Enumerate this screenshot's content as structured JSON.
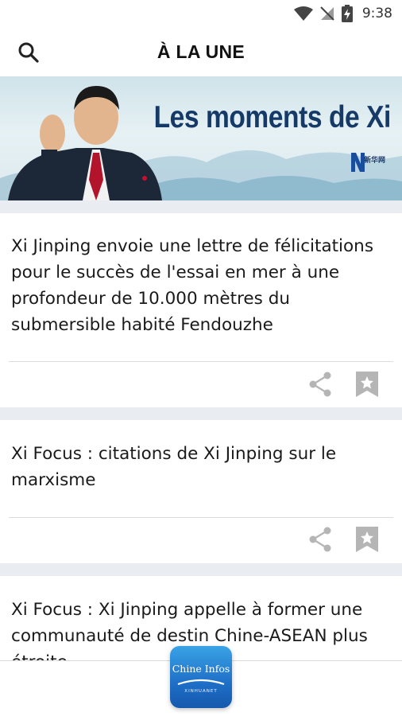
{
  "status_bar": {
    "time": "9:38"
  },
  "header": {
    "title": "À LA UNE"
  },
  "banner": {
    "title": "Les moments de Xi",
    "logo_text": "新华网"
  },
  "articles": [
    {
      "title": "Xi Jinping envoie une lettre de félicitations pour le succès de l'essai en mer à une profondeur de 10.000 mètres du submersible habité Fendouzhe"
    },
    {
      "title": "Xi Focus : citations de Xi Jinping sur le marxisme"
    },
    {
      "title": "Xi Focus : Xi Jinping appelle à former une communauté de destin Chine-ASEAN plus étroite"
    }
  ],
  "app_badge": {
    "name": "Chine Infos",
    "subtitle": "XINHUANET"
  },
  "colors": {
    "accent": "#163a67",
    "separator": "#e9ecf1",
    "icon": "#b5b5b5",
    "badge": "#1e6fc7"
  }
}
